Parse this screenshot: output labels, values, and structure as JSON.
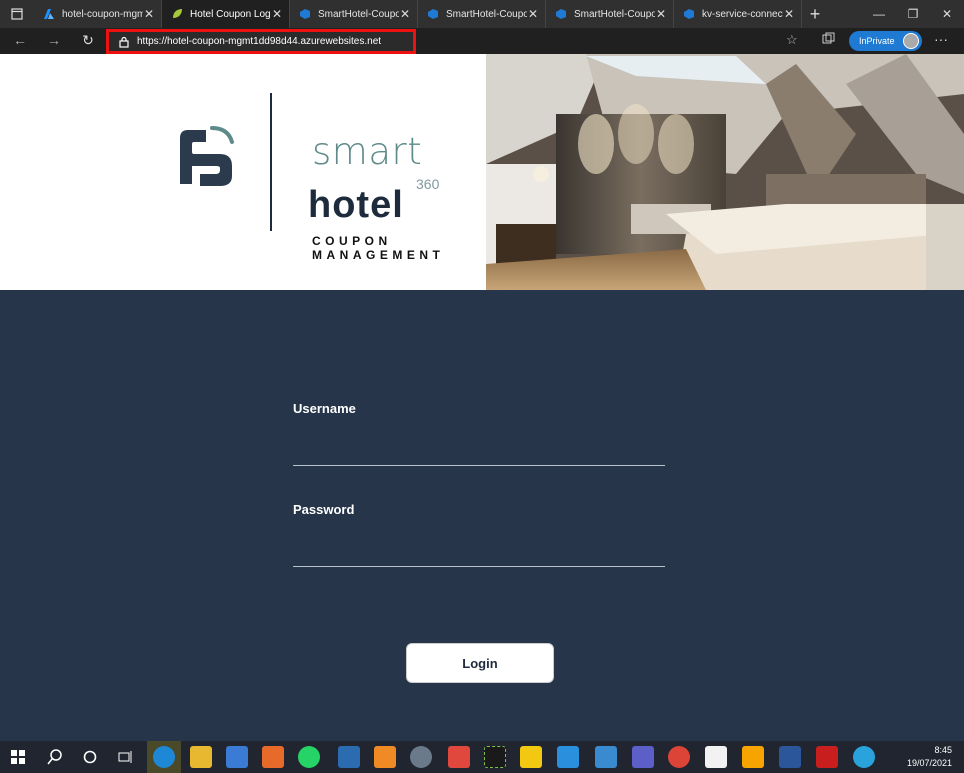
{
  "browser": {
    "tabs": [
      {
        "title": "hotel-coupon-mgmt",
        "icon": "azure-icon",
        "color": "#1e90ff"
      },
      {
        "title": "Hotel Coupon Login",
        "icon": "leaf-icon",
        "color": "#a6c93b"
      },
      {
        "title": "SmartHotel-Coupon",
        "icon": "devops-icon",
        "color": "#1e7ad3"
      },
      {
        "title": "SmartHotel-Coupon",
        "icon": "devops-icon",
        "color": "#1e7ad3"
      },
      {
        "title": "SmartHotel-Coupon",
        "icon": "devops-icon",
        "color": "#1e7ad3"
      },
      {
        "title": "kv-service-connecti",
        "icon": "devops-icon",
        "color": "#1e7ad3"
      }
    ],
    "url": "https://hotel-coupon-mgmt1dd98d44.azurewebsites.net",
    "inprivate_label": "InPrivate"
  },
  "brand": {
    "smart": "smart",
    "hotel": "hotel",
    "num": "360",
    "coupon": "COUPON",
    "management": "MANAGEMENT"
  },
  "form": {
    "username_label": "Username",
    "username_value": "",
    "password_label": "Password",
    "password_value": "",
    "login_label": "Login"
  },
  "taskbar": {
    "time": "8:45",
    "date": "19/07/2021"
  },
  "colors": {
    "page_bg": "#26354a",
    "accent": "#5f8a8a",
    "browser_accent": "#1e7ad3",
    "url_highlight": "#ee1111"
  }
}
